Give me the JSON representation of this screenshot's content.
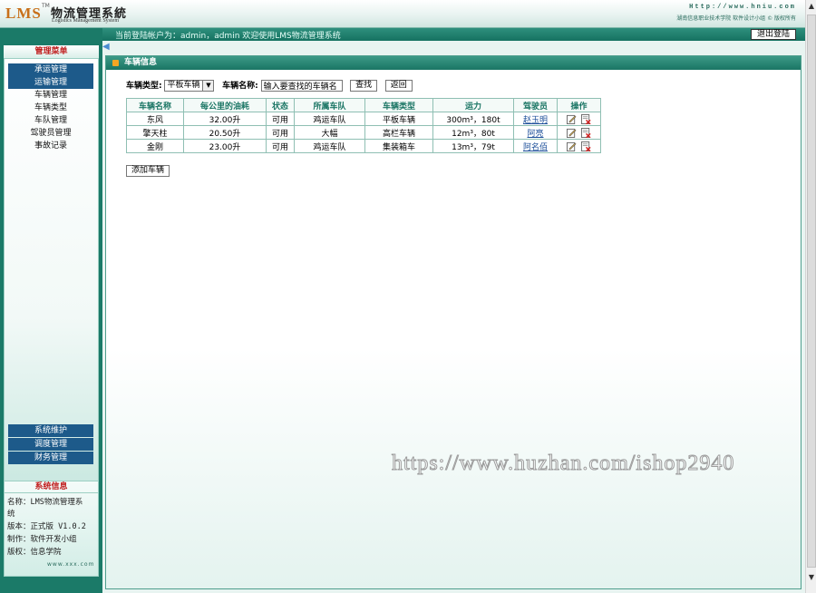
{
  "header": {
    "logo_lms": "LMS",
    "logo_tm": "TM",
    "logo_cn": "物流管理系統",
    "logo_en": "Logistics Management System",
    "url": "Http://www.hniu.com",
    "copyright": "湖南信息职业技术学院  软件设计小组 © 版权所有"
  },
  "topbar": {
    "login_info": "当前登陆帐户为：admin，admin 欢迎使用LMS物流管理系统",
    "logout_label": "退出登陆"
  },
  "sidebar": {
    "title": "管理菜单",
    "items": [
      {
        "label": "承运管理"
      },
      {
        "label": "运输管理"
      },
      {
        "label": "车辆管理"
      },
      {
        "label": "车辆类型"
      },
      {
        "label": "车队管理"
      },
      {
        "label": "驾驶员管理"
      },
      {
        "label": "事故记录"
      }
    ],
    "bottom_items": [
      {
        "label": "系统维护"
      },
      {
        "label": "调度管理"
      },
      {
        "label": "财务管理"
      }
    ],
    "sysinfo": {
      "title": "系统信息",
      "name_line1": "名称：LMS物流管理系",
      "name_line2": "统",
      "version": "版本：正式版 V1.0.2",
      "maker": "制作：软件开发小组",
      "rights": "版权：信息学院",
      "url": "www.xxx.com"
    }
  },
  "main": {
    "title": "车辆信息",
    "filter": {
      "type_label": "车辆类型:",
      "type_value": "平板车辆",
      "name_label": "车辆名称:",
      "name_value": "输入要查找的车辆名",
      "search_label": "查找",
      "back_label": "返回"
    },
    "table": {
      "headers": [
        "车辆名称",
        "每公里的油耗",
        "状态",
        "所属车队",
        "车辆类型",
        "运力",
        "驾驶员",
        "操作"
      ],
      "rows": [
        {
          "name": "东风",
          "fuel": "32.00升",
          "status": "可用",
          "team": "鸡运车队",
          "type": "平板车辆",
          "capacity": "300m³，180t",
          "driver": "赵玉明"
        },
        {
          "name": "擎天柱",
          "fuel": "20.50升",
          "status": "可用",
          "team": "大幅",
          "type": "高栏车辆",
          "capacity": "12m³，80t",
          "driver": "阿亮"
        },
        {
          "name": "金刚",
          "fuel": "23.00升",
          "status": "可用",
          "team": "鸡运车队",
          "type": "集装箱车",
          "capacity": "13m³，79t",
          "driver": "阿名佰"
        }
      ]
    },
    "add_label": "添加车辆"
  },
  "watermark": "https://www.huzhan.com/ishop2940"
}
